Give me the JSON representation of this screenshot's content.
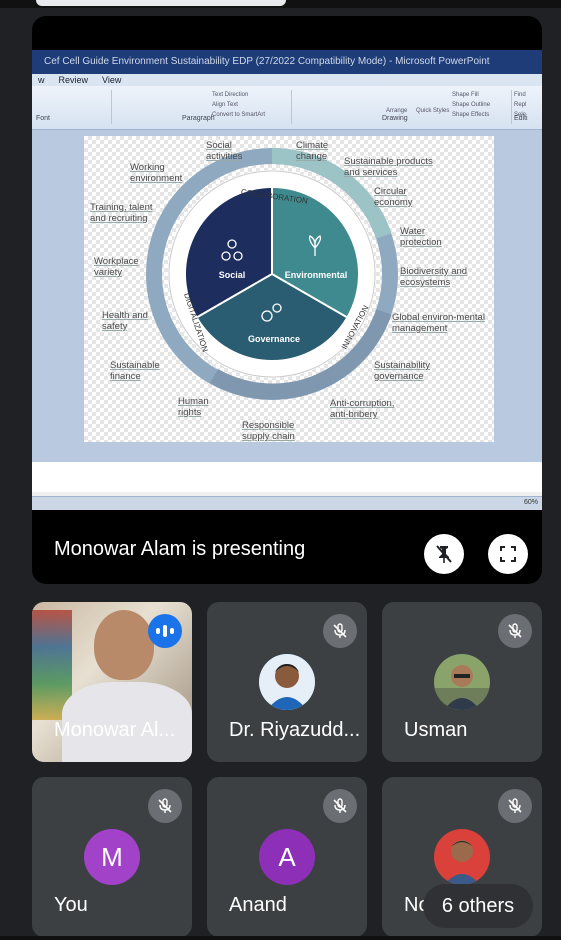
{
  "presentation": {
    "window_title": "Cef Cell Guide Environment Sustainability EDP (27/2022 Compatibility Mode) - Microsoft PowerPoint",
    "menu": [
      "w",
      "Review",
      "View"
    ],
    "ribbon_groups": [
      "Font",
      "Paragraph",
      "Drawing",
      "Editi"
    ],
    "ribbon_items": [
      "Text Direction",
      "Align Text",
      "Convert to SmartArt",
      "Arrange",
      "Quick Styles",
      "Shape Fill",
      "Shape Outline",
      "Shape Effects",
      "Find",
      "Repl",
      "Sele"
    ],
    "zoom": "60%",
    "slide": {
      "center": {
        "social": "Social",
        "environmental": "Environmental",
        "governance": "Governance"
      },
      "ring": {
        "collaboration": "COLLABORATION",
        "digitalization": "DIGITALIZATION",
        "innovation": "INNOVATION"
      },
      "labels": [
        "Social activities",
        "Climate change",
        "Sustainable products and services",
        "Working environment",
        "Circular economy",
        "Training, talent and recruiting",
        "Water protection",
        "Workplace variety",
        "Biodiversity and ecosystems",
        "Health and safety",
        "Global environ-mental management",
        "Sustainable finance",
        "Sustainability governance",
        "Human rights",
        "Anti-corruption, anti-bribery",
        "Responsible supply chain"
      ]
    }
  },
  "presenting_text": "Monowar Alam is presenting",
  "participants": [
    {
      "name": "Monowar Al...",
      "state": "speaking"
    },
    {
      "name": "Dr. Riyazudd...",
      "state": "muted"
    },
    {
      "name": "Usman",
      "state": "muted"
    },
    {
      "name": "You",
      "initial": "M",
      "color": "#a142c8",
      "state": "muted"
    },
    {
      "name": "Anand",
      "initial": "A",
      "color": "#8e2fb8",
      "state": "muted"
    },
    {
      "name": "No",
      "state": "muted"
    }
  ],
  "others_label": "6 others",
  "colors": {
    "background": "#202124",
    "tile": "#3c4043",
    "speaking": "#1a73e8",
    "social": "#1c2d5e",
    "environmental": "#3f8a8f",
    "governance": "#2b5d72"
  }
}
